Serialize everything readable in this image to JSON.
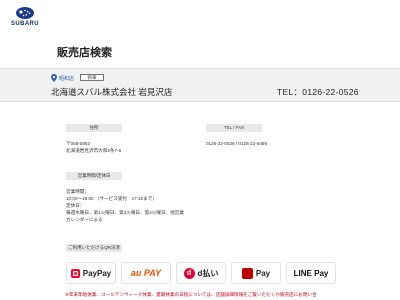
{
  "header": {
    "logo_text": "SUBARU"
  },
  "page": {
    "title": "販売店検索"
  },
  "dealer": {
    "region": "昭和店",
    "tag": "新車",
    "name": "北海道スバル株式会社 岩見沢店",
    "tel": "TEL：0126-22-0526"
  },
  "address": {
    "label": "住所",
    "postal": "〒068-0852",
    "line": "北海道岩見沢市大和2条7-6"
  },
  "contact": {
    "label": "TEL / FAX",
    "numbers": "0126-22-0526 / 0126-22-6489"
  },
  "hours": {
    "label": "営業時間/定休日",
    "lines": [
      "営業時間：",
      "10:00～18:00 （サービス受付　17:15まで）",
      "定休日：",
      "毎週水曜日、第1火曜日、第3火曜日、第4火曜日、他営業",
      "カレンダーによる"
    ]
  },
  "payments": {
    "label": "ご利用いただけるQR決済",
    "items": [
      {
        "name": "PayPay",
        "icon": "paypay-icon"
      },
      {
        "name": "au PAY",
        "icon": "au-pay-logo"
      },
      {
        "name": "d払い",
        "icon": "d-barai-icon"
      },
      {
        "name": "Pay",
        "icon": "rakuten-pay-icon"
      },
      {
        "name": "LINE Pay",
        "icon": "line-pay-logo"
      }
    ]
  },
  "note": "※年末年始休業、ゴールデンウィーク休業、夏期休業の日程については、店舗詳細情報をご覧いただくか販売店にお問い合"
}
